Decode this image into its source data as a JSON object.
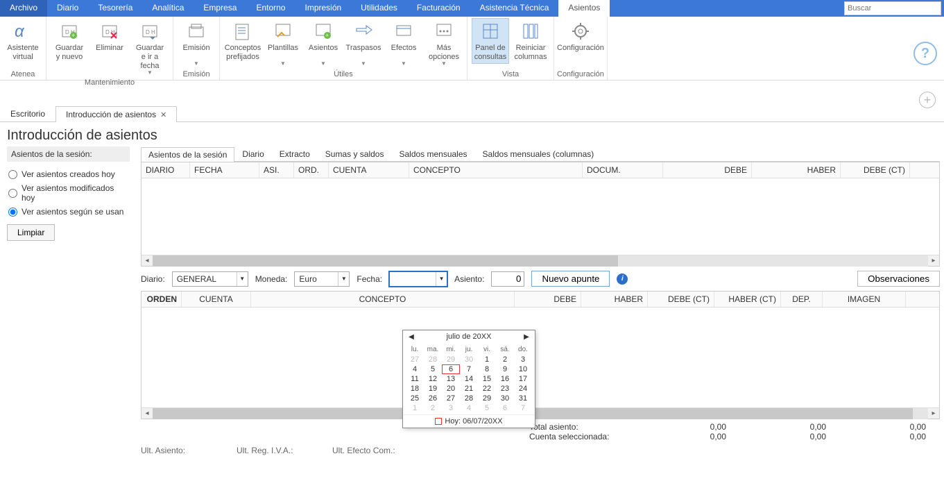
{
  "menu": {
    "items": [
      "Archivo",
      "Diario",
      "Tesorería",
      "Analítica",
      "Empresa",
      "Entorno",
      "Impresión",
      "Utilidades",
      "Facturación",
      "Asistencia Técnica",
      "Asientos"
    ],
    "active": 10,
    "search_placeholder": "Buscar"
  },
  "ribbon": {
    "groups": [
      {
        "label": "Atenea",
        "buttons": [
          {
            "label": "Asistente virtual",
            "key": "asistente"
          }
        ]
      },
      {
        "label": "Mantenimiento",
        "buttons": [
          {
            "label": "Guardar y nuevo",
            "key": "guardar-nuevo"
          },
          {
            "label": "Eliminar",
            "key": "eliminar"
          },
          {
            "label": "Guardar e ir a fecha",
            "key": "guardar-fecha",
            "dd": true
          }
        ]
      },
      {
        "label": "Emisión",
        "buttons": [
          {
            "label": "Emisión",
            "key": "emision",
            "dd": true
          }
        ]
      },
      {
        "label": "Útiles",
        "buttons": [
          {
            "label": "Conceptos prefijados",
            "key": "conceptos"
          },
          {
            "label": "Plantillas",
            "key": "plantillas",
            "dd": true
          },
          {
            "label": "Asientos",
            "key": "asientos-dd",
            "dd": true
          },
          {
            "label": "Traspasos",
            "key": "traspasos",
            "dd": true
          },
          {
            "label": "Efectos",
            "key": "efectos",
            "dd": true
          },
          {
            "label": "Más opciones",
            "key": "mas-opciones",
            "dd": true
          }
        ]
      },
      {
        "label": "Vista",
        "buttons": [
          {
            "label": "Panel de consultas",
            "key": "panel-consultas",
            "active": true
          },
          {
            "label": "Reiniciar columnas",
            "key": "reiniciar-cols"
          }
        ]
      },
      {
        "label": "Configuración",
        "buttons": [
          {
            "label": "Configuración",
            "key": "config"
          }
        ]
      }
    ]
  },
  "doc_tabs": [
    {
      "label": "Escritorio",
      "closable": false
    },
    {
      "label": "Introducción de asientos",
      "closable": true,
      "active": true
    }
  ],
  "page_title": "Introducción de asientos",
  "left": {
    "title": "Asientos de la sesión:",
    "radios": [
      {
        "label": "Ver asientos creados hoy",
        "checked": false
      },
      {
        "label": "Ver asientos modificados hoy",
        "checked": false
      },
      {
        "label": "Ver asientos según se usan",
        "checked": true
      }
    ],
    "clear_btn": "Limpiar"
  },
  "sub_tabs": [
    "Asientos de la sesión",
    "Diario",
    "Extracto",
    "Sumas y saldos",
    "Saldos mensuales",
    "Saldos mensuales (columnas)"
  ],
  "sub_tab_active": 0,
  "grid_top_cols": [
    "DIARIO",
    "FECHA",
    "ASI.",
    "ORD.",
    "CUENTA",
    "CONCEPTO",
    "DOCUM.",
    "DEBE",
    "HABER",
    "DEBE (CT)"
  ],
  "entry": {
    "diario_label": "Diario:",
    "diario_value": "GENERAL",
    "moneda_label": "Moneda:",
    "moneda_value": "Euro",
    "fecha_label": "Fecha:",
    "fecha_value": "",
    "asiento_label": "Asiento:",
    "asiento_value": "0",
    "new_btn": "Nuevo apunte",
    "obs_btn": "Observaciones"
  },
  "grid_bottom_cols": [
    "ORDEN",
    "CUENTA",
    "CONCEPTO",
    "DEBE",
    "HABER",
    "DEBE (CT)",
    "HABER (CT)",
    "DEP.",
    "IMAGEN"
  ],
  "datepicker": {
    "month_title": "julio de 20XX",
    "dows": [
      "lu.",
      "ma.",
      "mi.",
      "ju.",
      "vi.",
      "sá.",
      "do."
    ],
    "days": [
      {
        "n": "27",
        "o": true
      },
      {
        "n": "28",
        "o": true
      },
      {
        "n": "29",
        "o": true
      },
      {
        "n": "30",
        "o": true
      },
      {
        "n": "1"
      },
      {
        "n": "2"
      },
      {
        "n": "3"
      },
      {
        "n": "4"
      },
      {
        "n": "5"
      },
      {
        "n": "6",
        "today": true
      },
      {
        "n": "7"
      },
      {
        "n": "8"
      },
      {
        "n": "9"
      },
      {
        "n": "10"
      },
      {
        "n": "11"
      },
      {
        "n": "12"
      },
      {
        "n": "13"
      },
      {
        "n": "14"
      },
      {
        "n": "15"
      },
      {
        "n": "16"
      },
      {
        "n": "17"
      },
      {
        "n": "18"
      },
      {
        "n": "19"
      },
      {
        "n": "20"
      },
      {
        "n": "21"
      },
      {
        "n": "22"
      },
      {
        "n": "23"
      },
      {
        "n": "24"
      },
      {
        "n": "25"
      },
      {
        "n": "26"
      },
      {
        "n": "27"
      },
      {
        "n": "28"
      },
      {
        "n": "29"
      },
      {
        "n": "30"
      },
      {
        "n": "31"
      },
      {
        "n": "1",
        "o": true
      },
      {
        "n": "2",
        "o": true
      },
      {
        "n": "3",
        "o": true
      },
      {
        "n": "4",
        "o": true
      },
      {
        "n": "5",
        "o": true
      },
      {
        "n": "6",
        "o": true
      },
      {
        "n": "7",
        "o": true
      }
    ],
    "footer": "Hoy: 06/07/20XX"
  },
  "totals": {
    "total_label": "Total asiento:",
    "cuenta_label": "Cuenta seleccionada:",
    "cols": [
      {
        "a": "0,00",
        "b": "0,00"
      },
      {
        "a": "0,00",
        "b": "0,00"
      },
      {
        "a": "0,00",
        "b": "0,00"
      }
    ]
  },
  "status": {
    "ult_asiento": "Ult. Asiento:",
    "ult_reg_iva": "Ult. Reg. I.V.A.:",
    "ult_efecto": "Ult. Efecto Com.:"
  }
}
